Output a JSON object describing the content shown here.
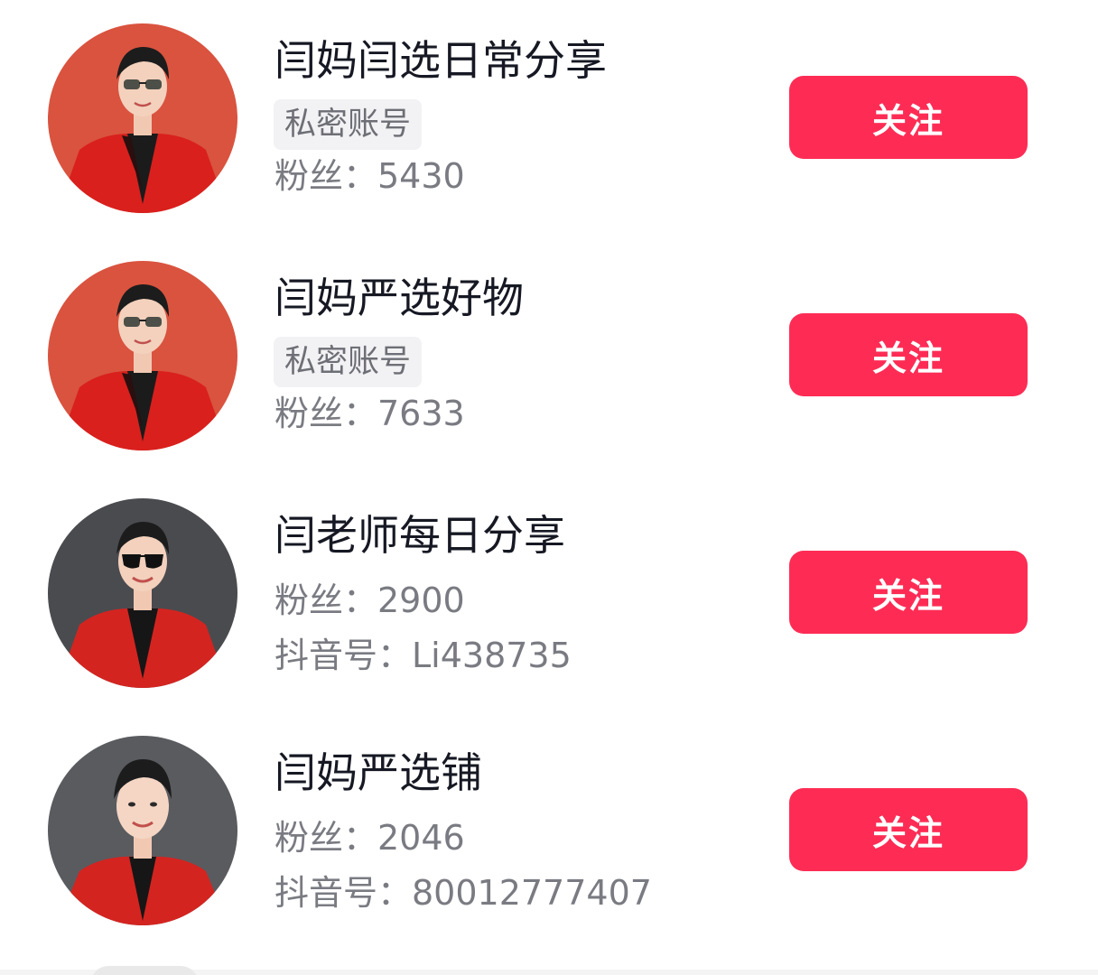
{
  "users": [
    {
      "name": "闫妈闫选日常分享",
      "badge": "私密账号",
      "fans": "粉丝：5430",
      "douyin_id": null,
      "follow_label": "关注",
      "avatar_bg": "#d9533f",
      "glasses": "tinted"
    },
    {
      "name": "闫妈严选好物",
      "badge": "私密账号",
      "fans": "粉丝：7633",
      "douyin_id": null,
      "follow_label": "关注",
      "avatar_bg": "#d9533f",
      "glasses": "tinted"
    },
    {
      "name": "闫老师每日分享",
      "badge": null,
      "fans": "粉丝：2900",
      "douyin_id": "抖音号：Li438735",
      "follow_label": "关注",
      "avatar_bg": "#4a4b4f",
      "glasses": "sunglasses"
    },
    {
      "name": "闫妈严选铺",
      "badge": null,
      "fans": "粉丝：2046",
      "douyin_id": "抖音号：80012777407",
      "follow_label": "关注",
      "avatar_bg": "#5a5b5f",
      "glasses": "none"
    }
  ],
  "colors": {
    "follow_button": "#fe2c55",
    "name_text": "#161823",
    "meta_text": "#7a7b82",
    "badge_bg": "#f2f2f4"
  }
}
